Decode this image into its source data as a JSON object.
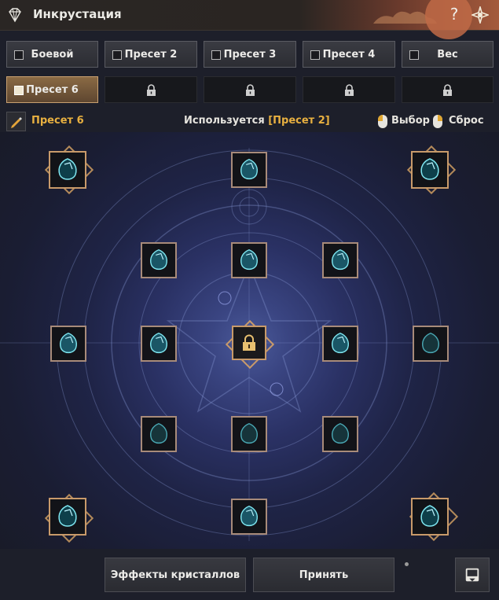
{
  "window": {
    "title": "Инкрустация",
    "help_label": "?"
  },
  "tabs": [
    {
      "label": "Боевой",
      "state": "normal"
    },
    {
      "label": "Пресет 2",
      "state": "normal"
    },
    {
      "label": "Пресет 3",
      "state": "normal"
    },
    {
      "label": "Пресет 4",
      "state": "normal"
    },
    {
      "label": "Вес",
      "state": "normal"
    },
    {
      "label": "Пресет 6",
      "state": "active"
    },
    {
      "label": "",
      "state": "locked"
    },
    {
      "label": "",
      "state": "locked"
    },
    {
      "label": "",
      "state": "locked"
    },
    {
      "label": "",
      "state": "locked"
    }
  ],
  "preset": {
    "name": "Пресет 6",
    "used_prefix": "Используется ",
    "used_value": "[Пресет 2]"
  },
  "hints": {
    "select": "Выбор",
    "reset": "Сброс"
  },
  "slots": {
    "crystal_icon": "crystal-icon",
    "center_icon": "lock-icon"
  },
  "bottom": {
    "effects_label": "Эффекты кристаллов",
    "accept_label": "Принять",
    "extra_icon": "tray-icon"
  },
  "colors": {
    "accent": "#e8b040",
    "active_tab": "#7a5c3c",
    "crystal": "#5fd0e0"
  }
}
